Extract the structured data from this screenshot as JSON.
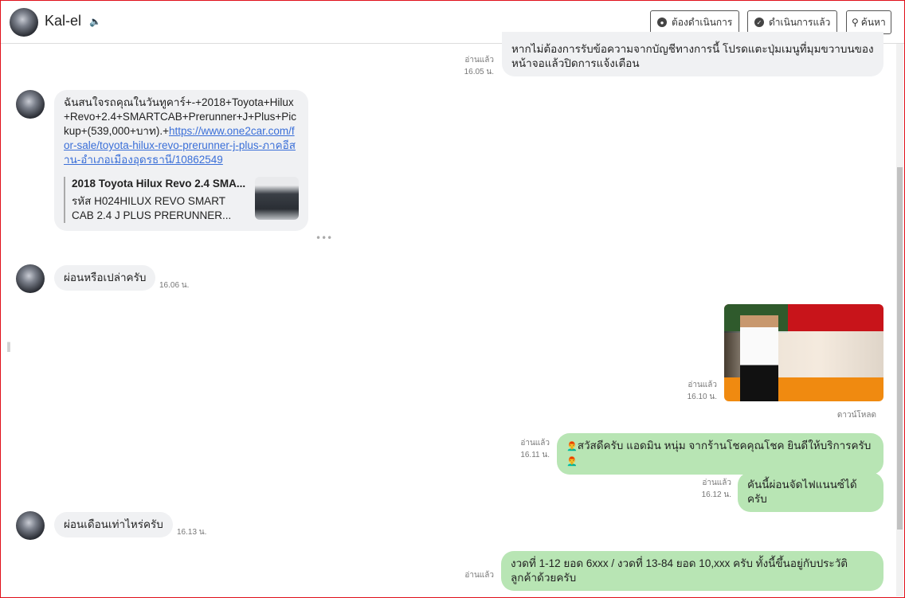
{
  "header": {
    "contact_name": "Kal-el",
    "buttons": [
      {
        "label": "ต้องดำเนินการ",
        "icon": "speech-bubble-icon"
      },
      {
        "label": "ดำเนินการแล้ว",
        "icon": "check-bubble-icon"
      },
      {
        "label": "ค้นหา",
        "icon": "search-icon"
      }
    ]
  },
  "messages": [
    {
      "dir": "out",
      "text": "หากไม่ต้องการรับข้อความจากบัญชีทางการนี้ โปรดแตะปุ่มเมนูที่มุมขวาบนของหน้าจอแล้วปิดการแจ้งเตือน",
      "status": "อ่านแล้ว",
      "time": "16.05 น."
    },
    {
      "dir": "in",
      "text": "ฉันสนใจรถคุณในวันทูคาร์+-+2018+Toyota+Hilux+Revo+2.4+SMARTCAB+Prerunner+J+Plus+Pickup+(539,000+บาท).+",
      "link": "https://www.one2car.com/for-sale/toyota-hilux-revo-prerunner-j-plus-ภาคอีสาน-อำเภอเมืองอุดรธานี/10862549",
      "preview_title": "2018 Toyota Hilux Revo 2.4 SMA...",
      "preview_desc": "รหัส H024HILUX REVO SMART CAB 2.4 J PLUS PRERUNNER..."
    },
    {
      "dir": "in",
      "text": "ผ่อนหรือเปล่าครับ",
      "time": "16.06 น."
    },
    {
      "dir": "out",
      "type": "image",
      "status": "อ่านแล้ว",
      "time": "16.10 น.",
      "download": "ดาวน์โหลด"
    },
    {
      "dir": "out",
      "text": "สวัสดีครับ แอดมิน หนุ่ม จากร้านโชคคุณโชค ยินดีให้บริการครับ",
      "emoji": "👨‍🦰",
      "status": "อ่านแล้ว",
      "time": "16.11 น."
    },
    {
      "dir": "out",
      "text": "คันนี้ผ่อนจัดไฟแนนซ์ได้ครับ",
      "status": "อ่านแล้ว",
      "time": "16.12 น."
    },
    {
      "dir": "in",
      "text": "ผ่อนเดือนเท่าไหร่ครับ",
      "time": "16.13 น."
    },
    {
      "dir": "out",
      "text": "งวดที่ 1-12 ยอด 6xxx / งวดที่ 13-84 ยอด 10,xxx ครับ ทั้งนี้ขึ้นอยู่กับประวัติลูกค้าด้วยครับ",
      "status": "อ่านแล้ว"
    }
  ],
  "colors": {
    "outgoing_bubble": "#b8e5b4",
    "incoming_bubble": "#f0f1f3",
    "link": "#3a6fd8"
  }
}
